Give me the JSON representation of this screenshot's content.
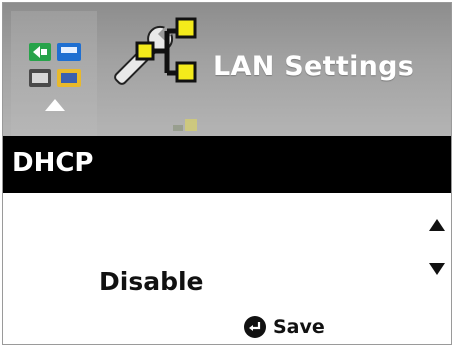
{
  "header": {
    "title": "LAN Settings",
    "lan_icon": "lan-tools-icon",
    "apps_icon": "app-grid-icon",
    "indicator_icon": "up-arrow-icon"
  },
  "section": {
    "title": "DHCP"
  },
  "setting": {
    "value": "Disable",
    "scroll_up_icon": "triangle-up-icon",
    "scroll_down_icon": "triangle-down-icon"
  },
  "footer": {
    "save_label": "Save",
    "save_icon": "enter-icon"
  },
  "colors": {
    "header_bg": "#9b9b9b",
    "section_bg": "#000000",
    "title_text": "#ffffff",
    "accent_yellow": "#f3ea1b",
    "body_text": "#111111"
  }
}
